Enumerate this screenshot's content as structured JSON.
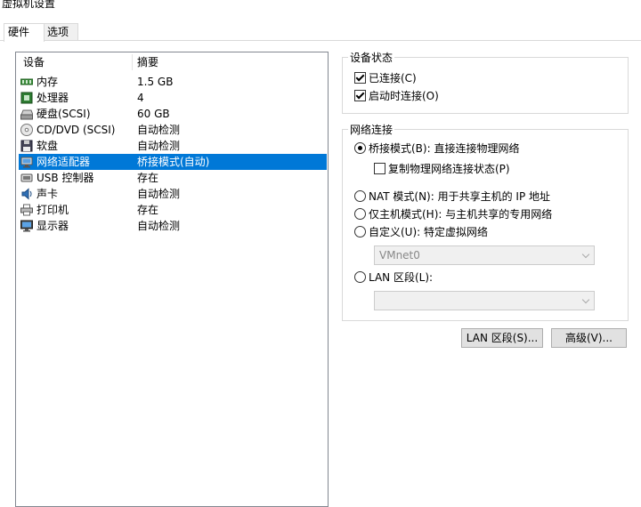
{
  "window": {
    "title": "虚拟机设置"
  },
  "tabs": [
    {
      "label": "硬件"
    },
    {
      "label": "选项"
    }
  ],
  "device_list": {
    "headers": {
      "device": "设备",
      "summary": "摘要"
    },
    "rows": [
      {
        "name": "内存",
        "summary": "1.5 GB",
        "icon": "memory-icon",
        "selected": false
      },
      {
        "name": "处理器",
        "summary": "4",
        "icon": "processor-icon",
        "selected": false
      },
      {
        "name": "硬盘(SCSI)",
        "summary": "60 GB",
        "icon": "harddisk-icon",
        "selected": false
      },
      {
        "name": "CD/DVD (SCSI)",
        "summary": "自动检测",
        "icon": "cd-dvd-icon",
        "selected": false
      },
      {
        "name": "软盘",
        "summary": "自动检测",
        "icon": "floppy-icon",
        "selected": false
      },
      {
        "name": "网络适配器",
        "summary": "桥接模式(自动)",
        "icon": "network-adapter-icon",
        "selected": true
      },
      {
        "name": "USB 控制器",
        "summary": "存在",
        "icon": "usb-icon",
        "selected": false
      },
      {
        "name": "声卡",
        "summary": "自动检测",
        "icon": "sound-icon",
        "selected": false
      },
      {
        "name": "打印机",
        "summary": "存在",
        "icon": "printer-icon",
        "selected": false
      },
      {
        "name": "显示器",
        "summary": "自动检测",
        "icon": "monitor-icon",
        "selected": false
      }
    ]
  },
  "device_status": {
    "title": "设备状态",
    "connected": {
      "label": "已连接(C)",
      "checked": true
    },
    "connect_at_power_on": {
      "label": "启动时连接(O)",
      "checked": true
    }
  },
  "network_connection": {
    "title": "网络连接",
    "bridged": {
      "label": "桥接模式(B): 直接连接物理网络",
      "selected": true
    },
    "replicate": {
      "label": "复制物理网络连接状态(P)",
      "checked": false
    },
    "nat": {
      "label": "NAT 模式(N): 用于共享主机的 IP 地址",
      "selected": false
    },
    "host_only": {
      "label": "仅主机模式(H): 与主机共享的专用网络",
      "selected": false
    },
    "custom": {
      "label": "自定义(U): 特定虚拟网络",
      "selected": false
    },
    "custom_dropdown": {
      "value": "VMnet0"
    },
    "lan_segment": {
      "label": "LAN 区段(L):",
      "selected": false
    },
    "lan_dropdown": {
      "value": ""
    }
  },
  "buttons": {
    "lan_segments": "LAN 区段(S)...",
    "advanced": "高级(V)..."
  },
  "colors": {
    "selection": "#0078d7",
    "border": "#d9d9d9"
  }
}
